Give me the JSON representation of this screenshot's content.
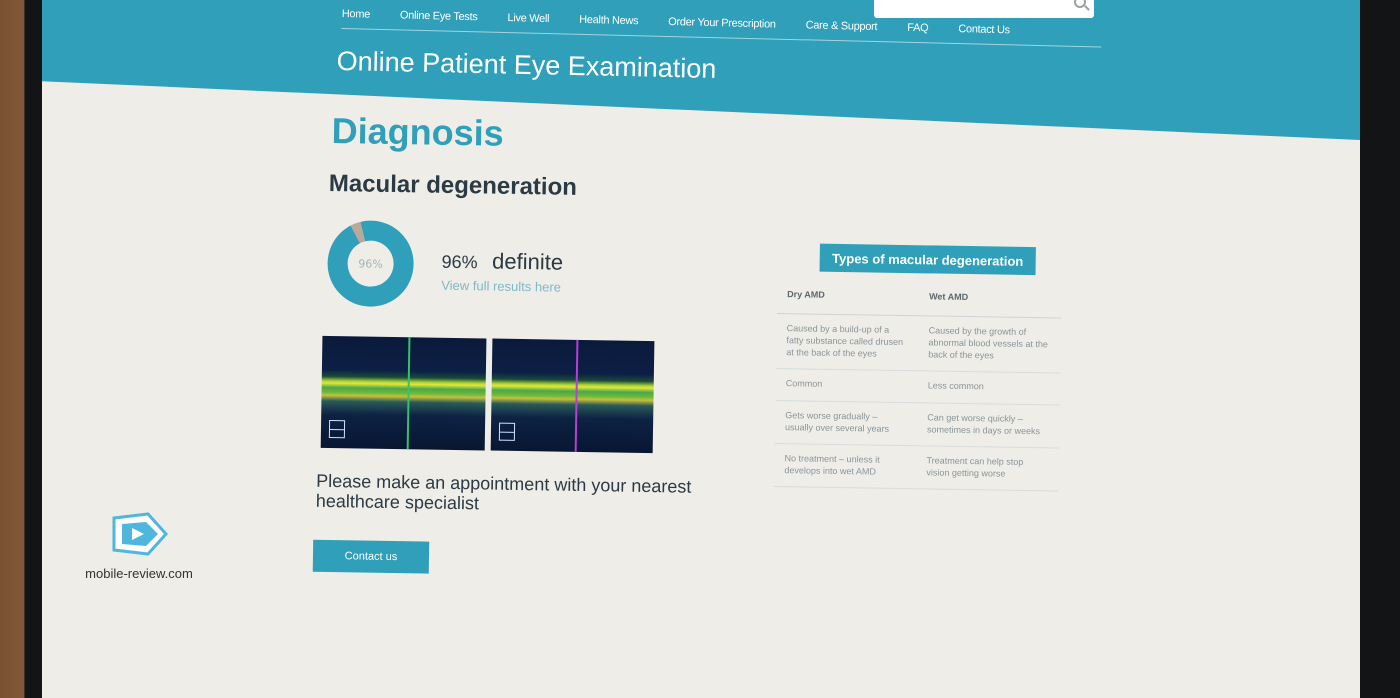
{
  "nav": {
    "items": [
      "Home",
      "Online Eye Tests",
      "Live Well",
      "Health News",
      "Order Your Prescription",
      "Care & Support",
      "FAQ",
      "Contact Us"
    ]
  },
  "site": {
    "title": "Online Patient Eye Examination"
  },
  "diagnosis": {
    "heading": "Diagnosis",
    "condition": "Macular degeneration",
    "donut_percent_label": "96%",
    "donut_fraction": 0.96,
    "percent": "96%",
    "certainty": "definite",
    "view_link": "View full results here"
  },
  "appointment": {
    "message": "Please make an appointment with your nearest healthcare specialist",
    "button_label": "Contact us"
  },
  "types": {
    "title": "Types of macular degeneration",
    "columns": [
      "Dry AMD",
      "Wet AMD"
    ],
    "rows": [
      [
        "Caused by a build-up of a fatty substance called drusen at the back of the eyes",
        "Caused by the growth of abnormal blood vessels at the back of the eyes"
      ],
      [
        "Common",
        "Less common"
      ],
      [
        "Gets worse gradually – usually over several years",
        "Can get worse quickly – sometimes in days or weeks"
      ],
      [
        "No treatment – unless it develops into wet AMD",
        "Treatment can help stop vision getting worse"
      ]
    ]
  },
  "watermark": {
    "text": "mobile-review.com"
  },
  "colors": {
    "brand": "#2f9fba",
    "donut_rest": "#b9a99a",
    "scan_marker_left": "#35c26a",
    "scan_marker_right": "#b83fd6"
  },
  "icons": {
    "search": "search-icon",
    "watermark_logo": "tag-logo-icon"
  }
}
